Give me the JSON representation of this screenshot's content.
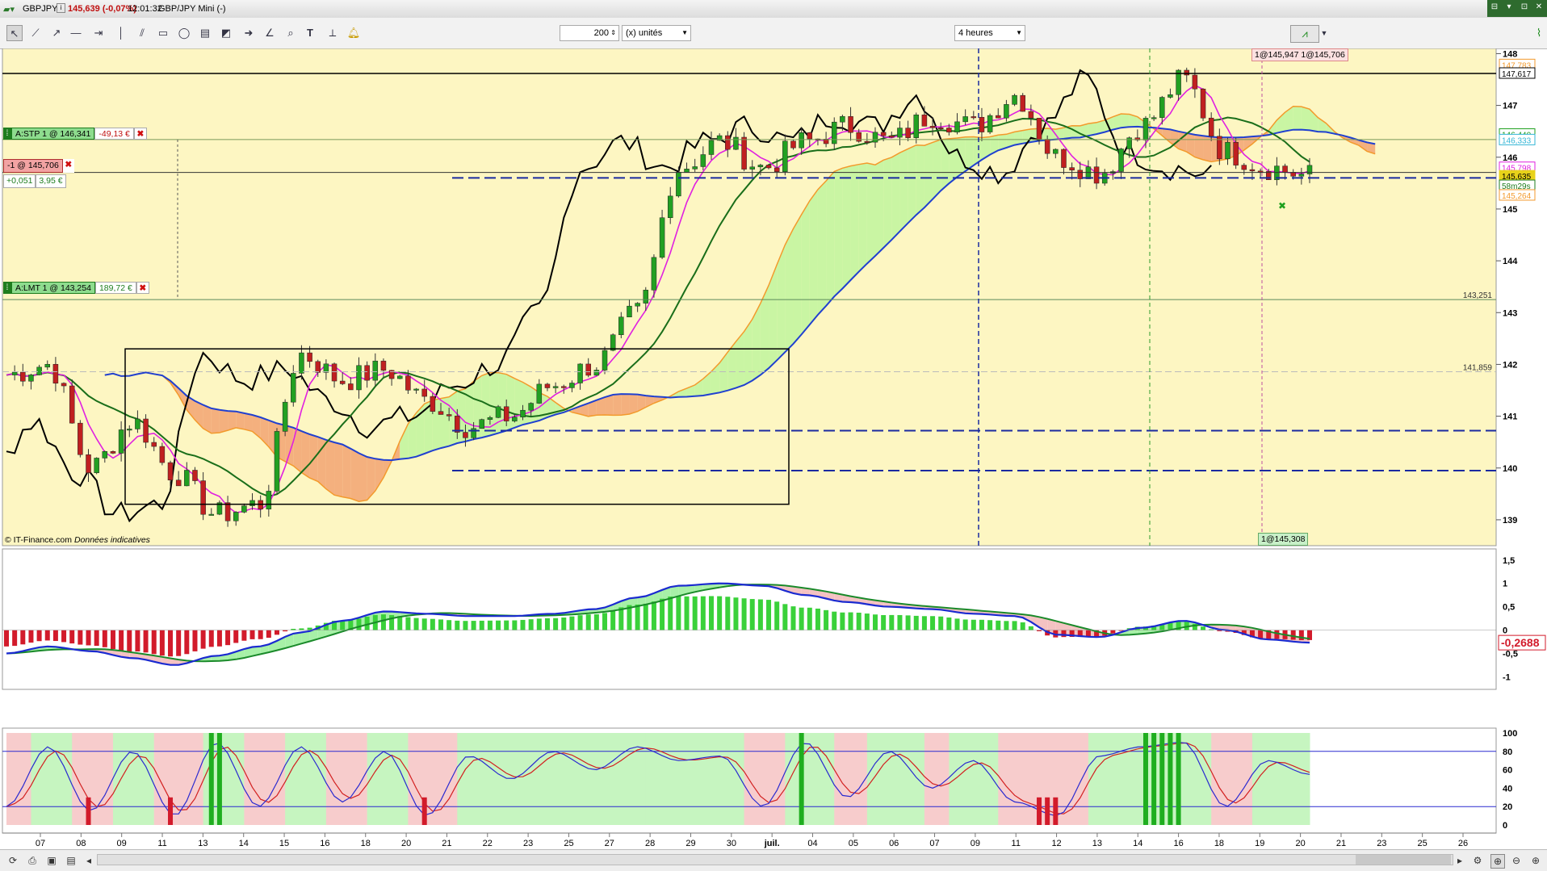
{
  "titlebar": {
    "symbol": "GBPJPY",
    "price_change": "145,639 (-0,07%)",
    "time": "12:01:32",
    "instrument": "GBP/JPY Mini (-)",
    "window_buttons": [
      "⊟",
      "▾",
      "⊡",
      "✕"
    ]
  },
  "toolbar": {
    "count_value": "200",
    "units_label": "(x) unités",
    "period_label": "4 heures"
  },
  "orders": {
    "stop": {
      "label": "A:STP  1 @ 146,341",
      "pnl": "-49,13 €"
    },
    "position": {
      "label": "-1 @ 145,706",
      "delta": "+0,051",
      "pnl": "3,95 €"
    },
    "limit": {
      "label": "A:LMT  1 @ 143,254",
      "pnl": "189,72 €"
    },
    "top_marker": "1@145,947  1@145,706",
    "bottom_marker": "1@145,308"
  },
  "price_panel": {
    "copyright": "© IT-Finance.com",
    "disclaimer": "Données indicatives",
    "y_ticks": [
      "148",
      "147",
      "146",
      "145",
      "144",
      "143",
      "142",
      "141",
      "140",
      "139"
    ],
    "line_labels": [
      "143,251",
      "141,859"
    ],
    "right_tags": [
      {
        "text": "147,783",
        "color": "#f39a2c"
      },
      {
        "text": "147,617",
        "color": "#000000"
      },
      {
        "text": "146,440",
        "color": "#1fa01f"
      },
      {
        "text": "146,333",
        "color": "#33b6d6"
      },
      {
        "text": "145,798",
        "color": "#e020e0"
      },
      {
        "text": "145,635",
        "color": "#e8d21a"
      },
      {
        "text": "58m29s",
        "color": "#1e7d1e"
      },
      {
        "text": "145,264",
        "color": "#f39a2c"
      }
    ]
  },
  "macd_panel": {
    "y_ticks": [
      "1,5",
      "1",
      "0,5",
      "0",
      "-0,5",
      "-1"
    ],
    "current_value": "-0,2688"
  },
  "stoch_panel": {
    "y_ticks": [
      "100",
      "80",
      "60",
      "40",
      "20",
      "0"
    ]
  },
  "x_axis": {
    "labels": [
      "07",
      "08",
      "09",
      "11",
      "13",
      "14",
      "15",
      "16",
      "18",
      "20",
      "21",
      "22",
      "23",
      "25",
      "27",
      "28",
      "29",
      "30",
      "juil.",
      "04",
      "05",
      "06",
      "07",
      "09",
      "11",
      "12",
      "13",
      "14",
      "16",
      "18",
      "19",
      "20",
      "21",
      "23",
      "25",
      "26"
    ]
  },
  "colors": {
    "chart_bg": "#fdf6c2",
    "cloud_bull": "#c9f5a3",
    "cloud_bear": "#f4b07e",
    "bull_candle": "#22a022",
    "bear_candle": "#c02020",
    "tenkan": "#e020e0",
    "kijun": "#1a6e1a",
    "chikou": "#000000"
  },
  "chart_data": [
    {
      "type": "line",
      "title": "GBPJPY",
      "ylim": [
        138.5,
        148.1
      ],
      "grid": false,
      "legend": "none",
      "x": [
        "07",
        "08",
        "09",
        "11",
        "13",
        "14",
        "15",
        "16",
        "18",
        "20",
        "21",
        "22",
        "23",
        "25",
        "27",
        "28",
        "29",
        "30",
        "juil.",
        "04",
        "05",
        "06",
        "07",
        "09",
        "11",
        "12",
        "13",
        "14",
        "16",
        "18",
        "19",
        "20"
      ],
      "series": [
        {
          "name": "",
          "values": [
            141.8,
            142.0,
            140.0,
            140.9,
            139.9,
            139.1,
            139.3,
            142.2,
            141.7,
            141.9,
            141.3,
            140.8,
            141.0,
            141.6,
            142.0,
            143.0,
            145.8,
            146.3,
            145.8,
            146.3,
            146.6,
            146.3,
            146.8,
            146.6,
            147.2,
            146.0,
            145.7,
            146.6,
            147.5,
            146.1,
            145.8,
            145.64
          ]
        }
      ]
    },
    {
      "type": "bar",
      "title": "",
      "ylim": [
        -1.2,
        1.6
      ],
      "x": [
        "07",
        "08",
        "09",
        "11",
        "13",
        "14",
        "15",
        "16",
        "18",
        "20",
        "21",
        "22",
        "23",
        "25",
        "27",
        "28",
        "29",
        "30",
        "juil.",
        "04",
        "05",
        "06",
        "07",
        "09",
        "11",
        "12",
        "13",
        "14",
        "16",
        "18",
        "19",
        "20"
      ],
      "series": [
        {
          "name": "",
          "values": [
            -0.5,
            -0.35,
            -0.45,
            -0.6,
            -0.75,
            -0.55,
            -0.35,
            -0.05,
            0.2,
            0.4,
            0.35,
            0.3,
            0.3,
            0.35,
            0.45,
            0.7,
            0.95,
            1.0,
            0.95,
            0.75,
            0.6,
            0.5,
            0.45,
            0.35,
            0.3,
            -0.1,
            -0.15,
            0.05,
            0.2,
            0.0,
            -0.2,
            -0.2688
          ]
        }
      ]
    },
    {
      "type": "line",
      "title": "",
      "ylim": [
        0,
        100
      ],
      "x": [
        "07",
        "08",
        "09",
        "11",
        "13",
        "14",
        "15",
        "16",
        "18",
        "20",
        "21",
        "22",
        "23",
        "25",
        "27",
        "28",
        "29",
        "30",
        "juil.",
        "04",
        "05",
        "06",
        "07",
        "09",
        "11",
        "12",
        "13",
        "14",
        "16",
        "18",
        "19",
        "20"
      ],
      "series": [
        {
          "name": "",
          "values": [
            20,
            85,
            15,
            80,
            10,
            90,
            20,
            85,
            25,
            80,
            10,
            75,
            50,
            80,
            60,
            85,
            70,
            75,
            20,
            90,
            30,
            80,
            40,
            70,
            25,
            10,
            75,
            85,
            90,
            20,
            70,
            55
          ]
        }
      ]
    }
  ]
}
